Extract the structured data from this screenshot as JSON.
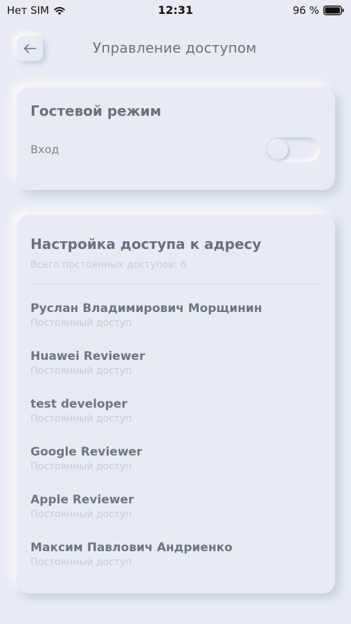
{
  "status_bar": {
    "carrier": "Нет SIM",
    "time": "12:31",
    "battery": "96 %"
  },
  "header": {
    "title": "Управление доступом",
    "back_icon": "arrow-left-icon"
  },
  "guest_mode": {
    "title": "Гостевой режим",
    "label": "Вход",
    "enabled": false
  },
  "access": {
    "title": "Настройка доступа к адресу",
    "subtitle": "Всего постоянных доступов: 6",
    "users": [
      {
        "name": "Руслан Владимирович Морщинин",
        "status": "Постоянный доступ"
      },
      {
        "name": "Huawei Reviewer",
        "status": "Постоянный доступ"
      },
      {
        "name": "test developer",
        "status": "Постоянный доступ"
      },
      {
        "name": "Google Reviewer",
        "status": "Постоянный доступ"
      },
      {
        "name": "Apple Reviewer",
        "status": "Постоянный доступ"
      },
      {
        "name": "Максим Павлович Андриенко",
        "status": "Постоянный доступ"
      }
    ]
  },
  "colors": {
    "background": "#e8ecf2",
    "title_text": "#6a7080",
    "muted_text": "#c4cbd8"
  }
}
